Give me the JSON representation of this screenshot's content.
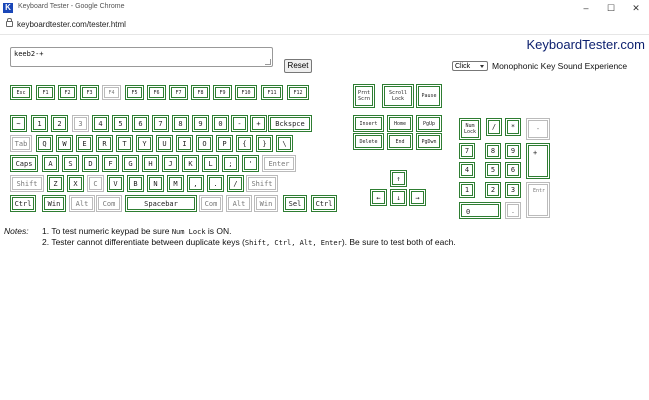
{
  "window": {
    "title": "Keyboard Tester - Google Chrome",
    "icon_letter": "K",
    "min_icon": "minimize-icon",
    "max_icon": "maximize-icon",
    "close_icon": "close-icon"
  },
  "address": {
    "url": "keyboardtester.com/tester.html"
  },
  "brand": "KeyboardTester.com",
  "input_text": "keeb2-+",
  "reset_label": "Reset",
  "sound": {
    "selected": "Click",
    "label": "Monophonic Key Sound Experience"
  },
  "colors": {
    "pressed_border": "#2e7d32",
    "brand": "#0b1f6e"
  },
  "keys": {
    "fn_row": [
      "Esc",
      "F1",
      "F2",
      "F3",
      "F4",
      "F5",
      "F6",
      "F7",
      "F8",
      "F9",
      "F10",
      "F11",
      "F12"
    ],
    "num_row": [
      "~",
      "1",
      "2",
      "3",
      "4",
      "5",
      "6",
      "7",
      "8",
      "9",
      "0",
      "-",
      "+",
      "Bckspce"
    ],
    "q_row": [
      "Tab",
      "Q",
      "W",
      "E",
      "R",
      "T",
      "Y",
      "U",
      "I",
      "O",
      "P",
      "{",
      "}",
      "\\"
    ],
    "a_row": [
      "Caps",
      "A",
      "S",
      "D",
      "F",
      "G",
      "H",
      "J",
      "K",
      "L",
      ";",
      "'",
      "Enter"
    ],
    "z_row": [
      "Shift",
      "Z",
      "X",
      "C",
      "V",
      "B",
      "N",
      "M",
      ",",
      ".",
      "/",
      "Shift"
    ],
    "bottom_row": [
      "Ctrl",
      "Win",
      "Alt",
      "Com",
      "Spacebar",
      "Com",
      "Alt",
      "Win",
      "Sel",
      "Ctrl"
    ],
    "sys": [
      "Prnt\nScrn",
      "Scroll\nLock",
      "Pause"
    ],
    "nav": [
      "Insert",
      "Home",
      "PgUp",
      "Delete",
      "End",
      "PgDwn"
    ],
    "arrows": [
      "↑",
      "←",
      "↓",
      "→"
    ],
    "numpad": [
      "Num\nLock",
      "/",
      "*",
      "-",
      "7",
      "8",
      "9",
      "+",
      "4",
      "5",
      "6",
      "1",
      "2",
      "3",
      "Entr",
      "0",
      "."
    ]
  },
  "notes": {
    "label": "Notes:",
    "n1_num": "1.",
    "n1_pre": "To test numeric keypad be sure",
    "n1_code": "Num Lock",
    "n1_post": "is ON.",
    "n2_num": "2.",
    "n2_pre": "Tester cannot differentiate between duplicate keys (",
    "n2_code": "Shift, Ctrl, Alt, Enter",
    "n2_post": "). Be sure to test both of each."
  }
}
